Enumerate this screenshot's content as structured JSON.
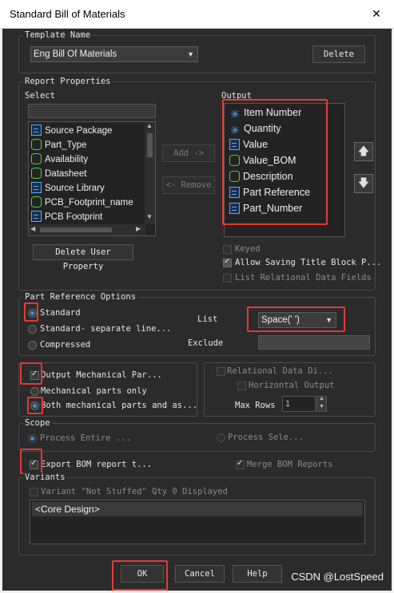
{
  "window": {
    "title": "Standard Bill of Materials",
    "close_glyph": "✕"
  },
  "template": {
    "group_label": "Template Name",
    "selected": "Eng Bill Of Materials",
    "delete_label": "Delete"
  },
  "report": {
    "group_label": "Report Properties",
    "select_label": "Select",
    "output_label": "Output",
    "select_items": [
      {
        "label": "Source Package",
        "icon": "doc-icon"
      },
      {
        "label": "Part_Type",
        "icon": "cylinder-icon"
      },
      {
        "label": "Availability",
        "icon": "cylinder-icon"
      },
      {
        "label": "Datasheet",
        "icon": "cylinder-icon"
      },
      {
        "label": "Source Library",
        "icon": "doc-icon"
      },
      {
        "label": "PCB_Footprint_name",
        "icon": "cylinder-icon"
      },
      {
        "label": "PCB Footprint",
        "icon": "doc-icon"
      }
    ],
    "output_items": [
      {
        "label": "Item Number",
        "icon": "star-icon"
      },
      {
        "label": "Quantity",
        "icon": "star-icon"
      },
      {
        "label": "Value",
        "icon": "doc-icon"
      },
      {
        "label": "Value_BOM",
        "icon": "cylinder-icon"
      },
      {
        "label": "Description",
        "icon": "cylinder-icon"
      },
      {
        "label": "Part Reference",
        "icon": "doc-icon"
      },
      {
        "label": "Part_Number",
        "icon": "doc-icon"
      }
    ],
    "add_label": "Add ->",
    "remove_label": "<- Remove",
    "delete_user_property": "Delete User Property",
    "keyed_label": "Keyed",
    "allow_saving_label": "Allow Saving Title Block P...",
    "list_relational_label": "List Relational Data Fields",
    "move_up_glyph": "🡅",
    "move_down_glyph": "🡇"
  },
  "part_ref": {
    "group_label": "Part Reference Options",
    "standard_label": "Standard",
    "standard_separate_label": "Standard- separate line...",
    "compressed_label": "Compressed",
    "list_label": "List",
    "list_value": "Space(' ')",
    "exclude_label": "Exclude"
  },
  "mech": {
    "output_mechanical_label": "Output Mechanical Par...",
    "mechanical_only_label": "Mechanical parts only",
    "both_label": "Both mechanical parts and as..."
  },
  "relational": {
    "relational_label": "Relational Data Di...",
    "horizontal_label": "Horizontal Output",
    "max_rows_label": "Max Rows",
    "max_rows_value": "1"
  },
  "scope": {
    "group_label": "Scope",
    "process_entire_label": "Process Entire ...",
    "process_selection_label": "Process Sele..."
  },
  "export": {
    "export_bom_label": "Export BOM report t...",
    "merge_label": "Merge BOM Reports"
  },
  "variants": {
    "group_label": "Variants",
    "not_stuffed_label": "Variant \"Not Stuffed\" Qty 0 Displayed",
    "items": [
      "<Core Design>"
    ]
  },
  "footer": {
    "ok_label": "OK",
    "cancel_label": "Cancel",
    "help_label": "Help"
  },
  "watermark": "CSDN @LostSpeed"
}
